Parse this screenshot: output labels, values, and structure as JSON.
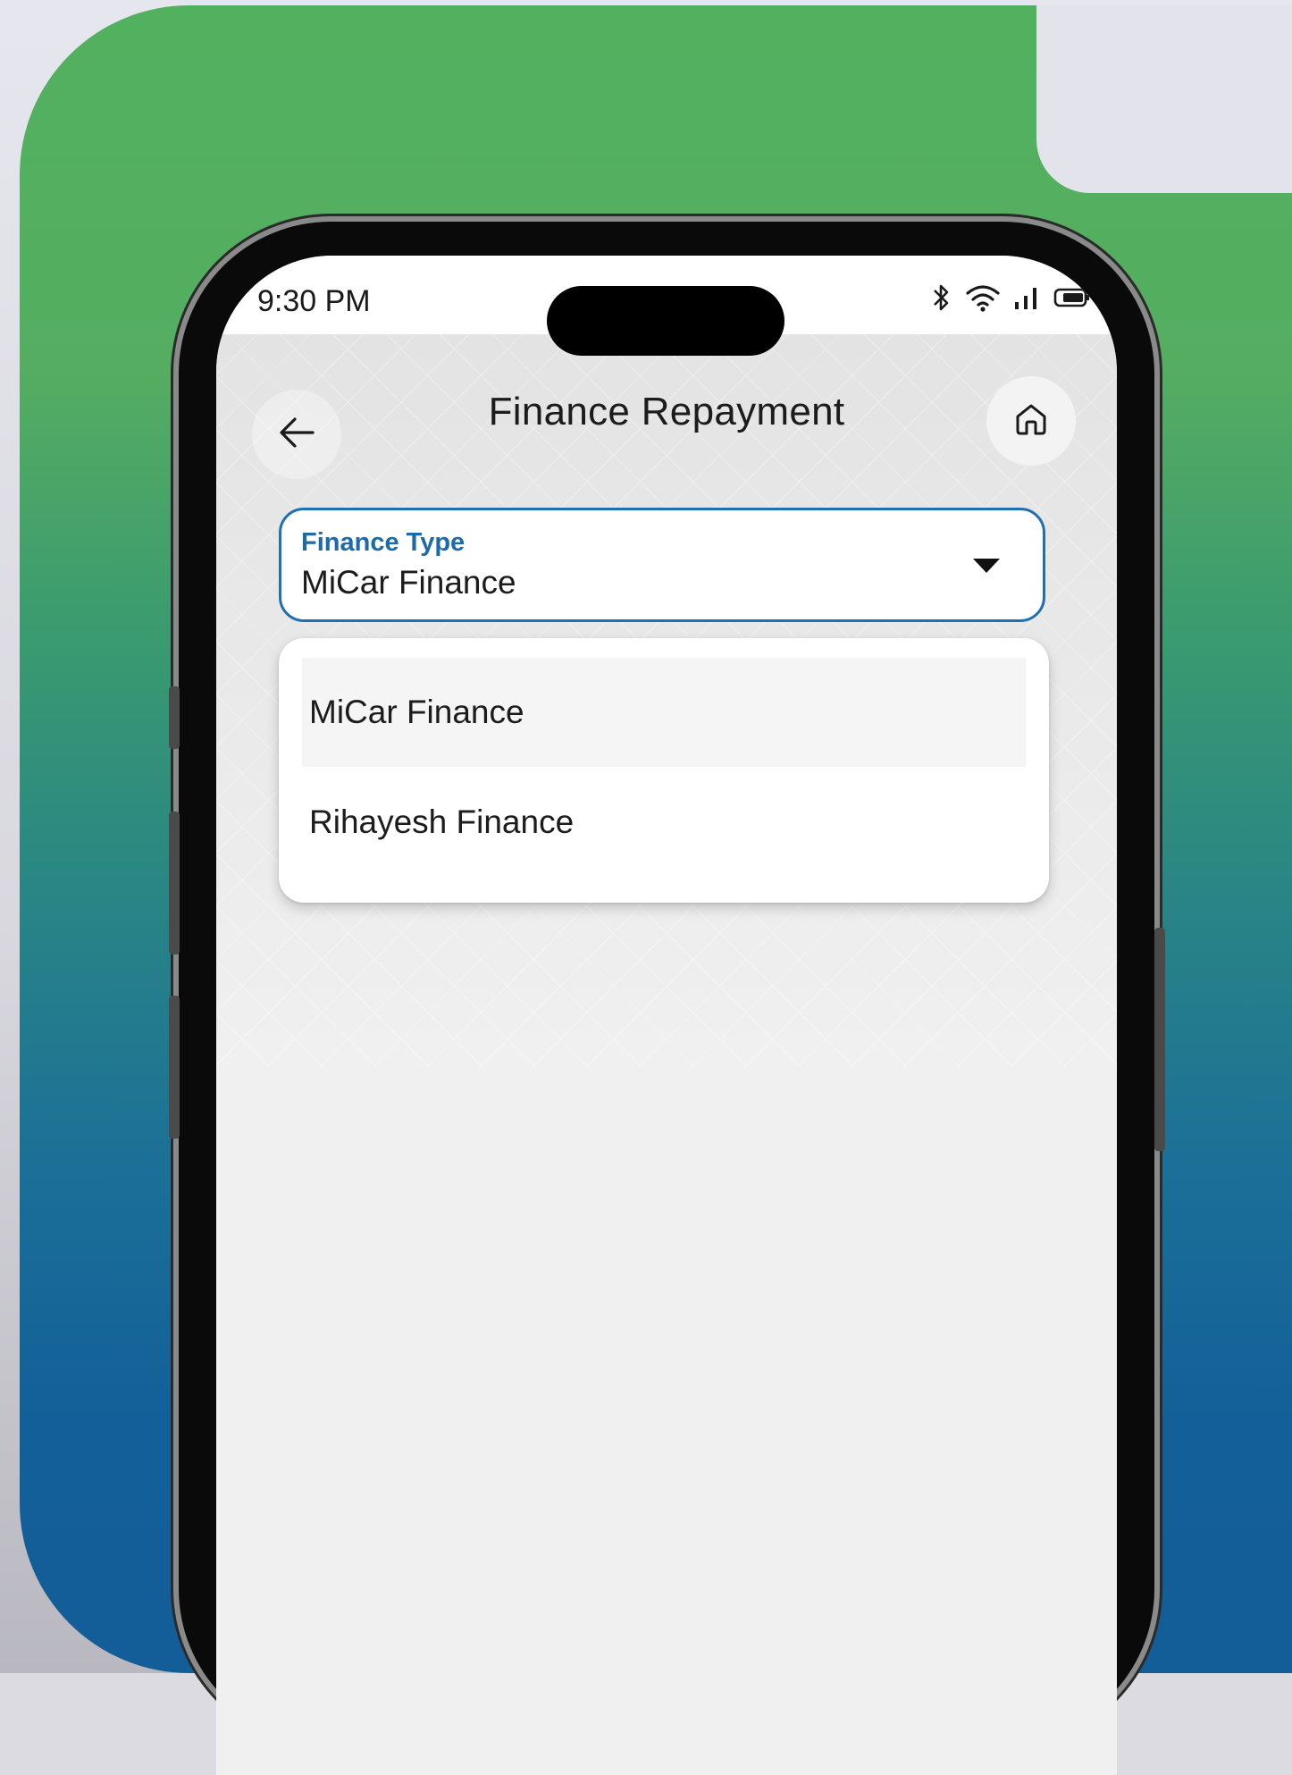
{
  "status_bar": {
    "time": "9:30 PM",
    "icons": [
      "bluetooth-icon",
      "wifi-icon",
      "signal-icon",
      "battery-icon"
    ]
  },
  "header": {
    "title": "Finance Repayment",
    "back_icon": "arrow-left-icon",
    "home_icon": "home-icon"
  },
  "finance_type_field": {
    "label": "Finance Type",
    "value": "MiCar Finance",
    "accent_color": "#1f6fb5"
  },
  "dropdown": {
    "options": [
      {
        "label": "MiCar Finance",
        "selected": true
      },
      {
        "label": "Rihayesh Finance",
        "selected": false
      }
    ]
  },
  "colors": {
    "card_green": "#52b15f",
    "card_blue": "#135e98"
  }
}
